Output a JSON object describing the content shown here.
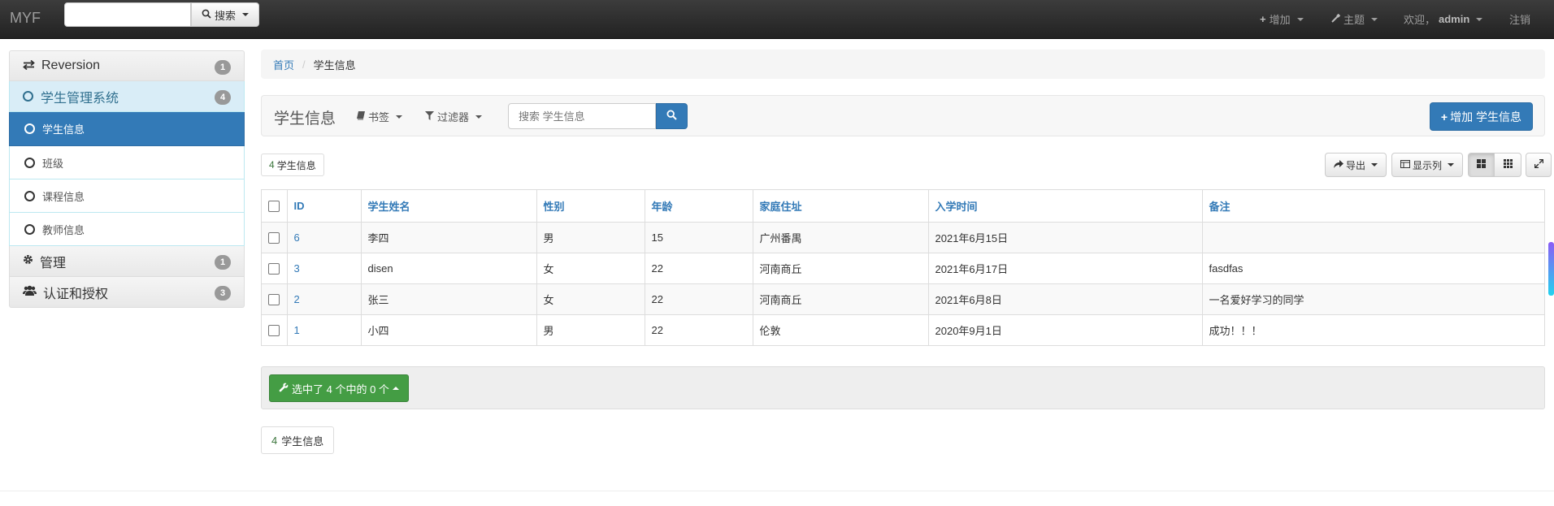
{
  "navbar": {
    "brand": "MYF",
    "search_label": "搜索",
    "add_label": "增加",
    "theme_label": "主题",
    "welcome_prefix": "欢迎，",
    "username": "admin",
    "logout_label": "注销"
  },
  "sidebar": {
    "groups": [
      {
        "label": "Reversion",
        "badge": "1"
      },
      {
        "label": "学生管理系统",
        "badge": "4"
      },
      {
        "label": "管理",
        "badge": "1"
      },
      {
        "label": "认证和授权",
        "badge": "3"
      }
    ],
    "items": [
      {
        "label": "学生信息"
      },
      {
        "label": "班级"
      },
      {
        "label": "课程信息"
      },
      {
        "label": "教师信息"
      }
    ]
  },
  "breadcrumb": {
    "home": "首页",
    "current": "学生信息"
  },
  "header": {
    "title": "学生信息",
    "bookmarks_label": "书签",
    "filters_label": "过滤器",
    "search_placeholder": "搜索 学生信息",
    "add_button_label": "增加 学生信息"
  },
  "count_label": {
    "num": "4",
    "text": "学生信息"
  },
  "toolbar": {
    "export_label": "导出",
    "columns_label": "显示列"
  },
  "table": {
    "columns": [
      "ID",
      "学生姓名",
      "性别",
      "年龄",
      "家庭住址",
      "入学时间",
      "备注"
    ],
    "rows": [
      {
        "id": "6",
        "name": "李四",
        "gender": "男",
        "age": "15",
        "address": "广州番禺",
        "date": "2021年6月15日",
        "note": ""
      },
      {
        "id": "3",
        "name": "disen",
        "gender": "女",
        "age": "22",
        "address": "河南商丘",
        "date": "2021年6月17日",
        "note": "fasdfas"
      },
      {
        "id": "2",
        "name": "张三",
        "gender": "女",
        "age": "22",
        "address": "河南商丘",
        "date": "2021年6月8日",
        "note": "一名爱好学习的同学"
      },
      {
        "id": "1",
        "name": "小四",
        "gender": "男",
        "age": "22",
        "address": "伦敦",
        "date": "2020年9月1日",
        "note": "成功！！！"
      }
    ]
  },
  "actions": {
    "selected_label": "选中了 4 个中的 0 个"
  },
  "bottom_count": {
    "num": "4",
    "text": "学生信息"
  },
  "colors": {
    "primary": "#337ab7",
    "success": "#449d44",
    "navbar": "#222222",
    "active_app": "#d9edf7"
  }
}
